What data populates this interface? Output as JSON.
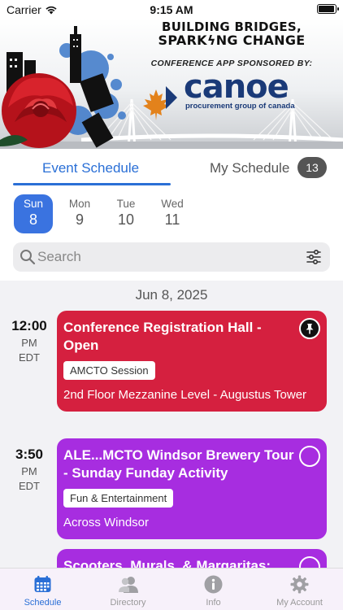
{
  "status_bar": {
    "carrier": "Carrier",
    "time": "9:15 AM",
    "battery_level": 1.0
  },
  "banner": {
    "title_line1": "BUILDING BRIDGES,",
    "title_line2": "SPARKϟNG CHANGE",
    "sponsor_label": "CONFERENCE APP SPONSORED BY:",
    "logo_word": "canoe",
    "logo_subtitle": "procurement group of canada"
  },
  "segments": {
    "event_schedule": "Event Schedule",
    "my_schedule": "My Schedule",
    "my_schedule_count": "13"
  },
  "days": [
    {
      "dow": "Sun",
      "num": "8",
      "active": true
    },
    {
      "dow": "Mon",
      "num": "9",
      "active": false
    },
    {
      "dow": "Tue",
      "num": "10",
      "active": false
    },
    {
      "dow": "Wed",
      "num": "11",
      "active": false
    }
  ],
  "search": {
    "placeholder": "Search"
  },
  "schedule": {
    "date_header": "Jun 8, 2025",
    "events": [
      {
        "time": "12:00",
        "ampm": "PM",
        "tz": "EDT",
        "title": "Conference Registration Hall - Open",
        "tag": "AMCTO Session",
        "location": "2nd Floor Mezzanine Level - Augustus Tower",
        "color": "#d5203f",
        "pinned": true
      },
      {
        "time": "3:50",
        "ampm": "PM",
        "tz": "EDT",
        "title": "ALE...MCTO Windsor Brewery Tour - Sunday Funday Activity",
        "tag": "Fun & Entertainment",
        "location": "Across Windsor",
        "color": "#a72de0",
        "pinned": false
      },
      {
        "title": "Scooters, Murals, & Margaritas:",
        "color": "#a72de0",
        "pinned": false
      }
    ]
  },
  "tabbar": {
    "schedule": "Schedule",
    "directory": "Directory",
    "info": "Info",
    "account": "My Account"
  },
  "colors": {
    "accent": "#2a6fd6",
    "active_day": "#3a73e0",
    "event_red": "#d5203f",
    "event_purple": "#a72de0"
  }
}
